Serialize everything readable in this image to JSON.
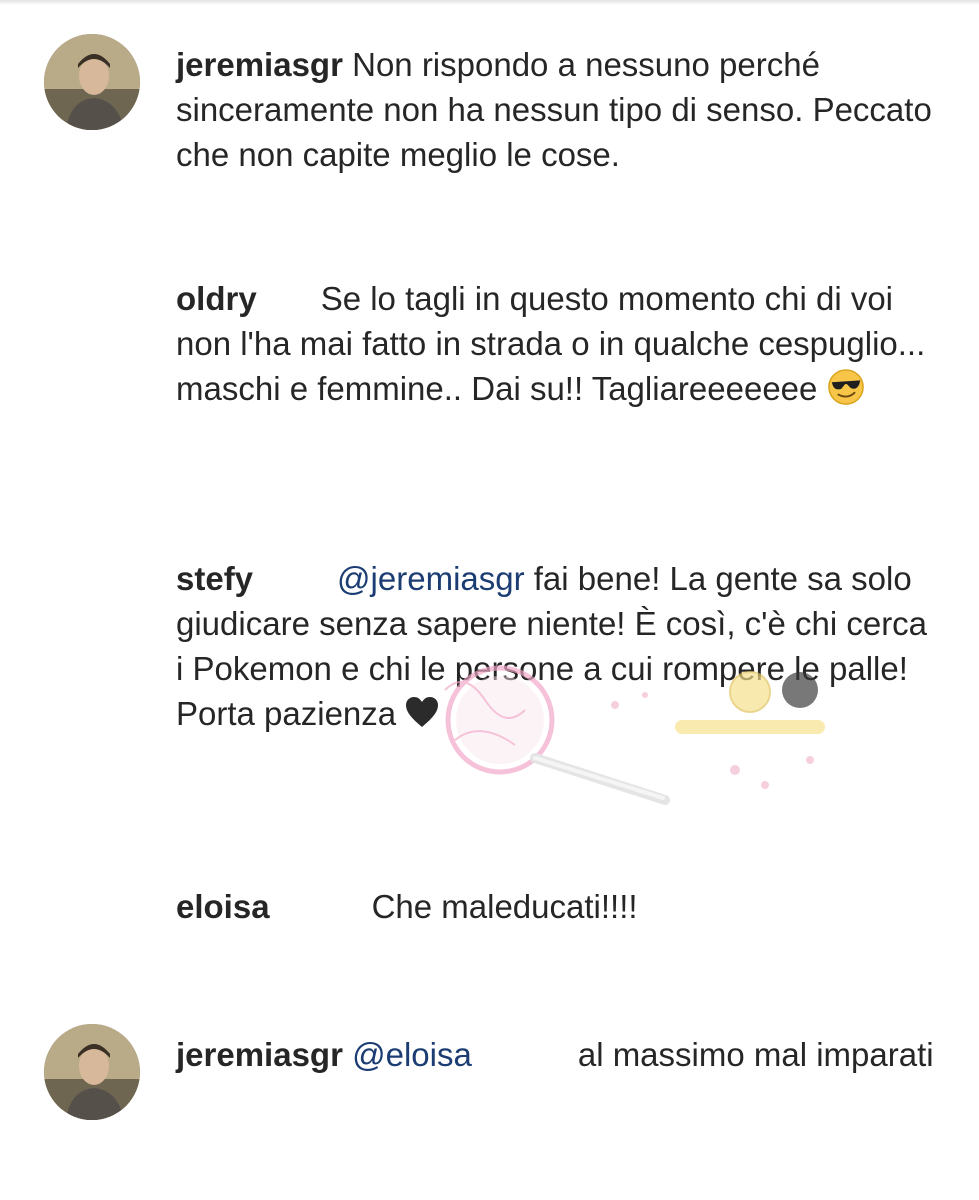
{
  "comments": [
    {
      "username": "jeremiasgr",
      "text": "Non rispondo a nessuno perché sinceramente non ha nessun tipo di senso. Peccato che non capite meglio le cose.",
      "has_avatar": true
    },
    {
      "username": "oldry",
      "text": "Se lo tagli in questo momento chi di voi non l'ha mai fatto in strada o in qualche cespuglio... maschi e femmine.. Dai su!! Tagliareeeeeee",
      "emoji": "sunglasses-face"
    },
    {
      "username": "stefy",
      "mention": "@jeremiasgr",
      "text": "fai bene!  La gente sa solo giudicare senza sapere niente! È così, c'è chi cerca i Pokemon e chi le persone a cui rompere le palle!  Porta pazienza",
      "emoji": "black-heart"
    },
    {
      "username": "eloisa",
      "text": "Che maleducati!!!!"
    },
    {
      "username": "jeremiasgr",
      "mention": "@eloisa",
      "text": "al massimo mal imparati",
      "has_avatar": true
    }
  ],
  "colors": {
    "text": "#262626",
    "mention": "#1c3d73",
    "background": "#ffffff",
    "watermark_pink": "#f2a7c7"
  }
}
